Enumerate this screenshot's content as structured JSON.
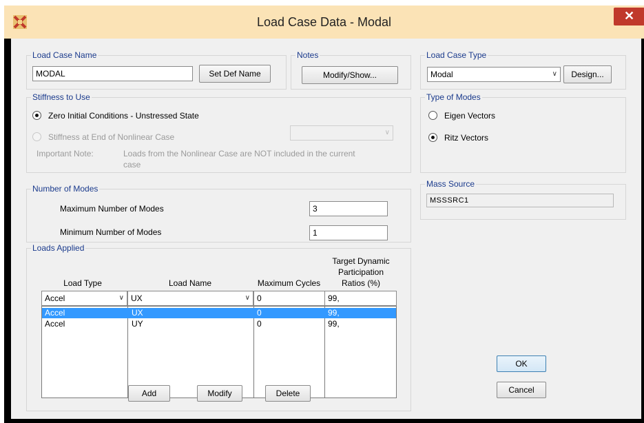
{
  "window": {
    "title": "Load Case Data - Modal",
    "close_glyph": "✕"
  },
  "load_case_name": {
    "legend": "Load Case Name",
    "value": "MODAL",
    "set_def_button": "Set Def Name"
  },
  "notes": {
    "legend": "Notes",
    "button": "Modify/Show..."
  },
  "load_case_type": {
    "legend": "Load Case Type",
    "selected": "Modal",
    "design_button": "Design..."
  },
  "stiffness": {
    "legend": "Stiffness to Use",
    "option_zero": "Zero Initial Conditions - Unstressed State",
    "option_nonlinear": "Stiffness at End of Nonlinear Case",
    "nonlinear_case_value": "",
    "note_label": "Important Note:",
    "note_text_line1": "Loads from the Nonlinear Case are NOT included in the current",
    "note_text_line2": "case",
    "selected": "zero"
  },
  "type_of_modes": {
    "legend": "Type of Modes",
    "option_eigen": "Eigen Vectors",
    "option_ritz": "Ritz Vectors",
    "selected": "ritz"
  },
  "mass_source": {
    "legend": "Mass Source",
    "value": "MSSSRC1"
  },
  "number_of_modes": {
    "legend": "Number of Modes",
    "max_label": "Maximum Number of Modes",
    "max_value": "3",
    "min_label": "Minimum Number of Modes",
    "min_value": "1"
  },
  "loads_applied": {
    "legend": "Loads Applied",
    "headers": {
      "load_type": "Load Type",
      "load_name": "Load Name",
      "max_cycles": "Maximum Cycles",
      "target_line1": "Target Dynamic",
      "target_line2": "Participation",
      "target_line3": "Ratios (%)"
    },
    "edit_row": {
      "load_type": "Accel",
      "load_name": "UX",
      "max_cycles": "0",
      "target": "99,"
    },
    "rows": [
      {
        "load_type": "Accel",
        "load_name": "UX",
        "max_cycles": "0",
        "target": "99,",
        "selected": true
      },
      {
        "load_type": "Accel",
        "load_name": "UY",
        "max_cycles": "0",
        "target": "99,",
        "selected": false
      }
    ],
    "add_button": "Add",
    "modify_button": "Modify",
    "delete_button": "Delete"
  },
  "ok_button": "OK",
  "cancel_button": "Cancel",
  "colors": {
    "titlebar": "#fbe3b6",
    "close": "#c0392b",
    "legend_text": "#1a3a8c",
    "selection": "#3399ff"
  }
}
